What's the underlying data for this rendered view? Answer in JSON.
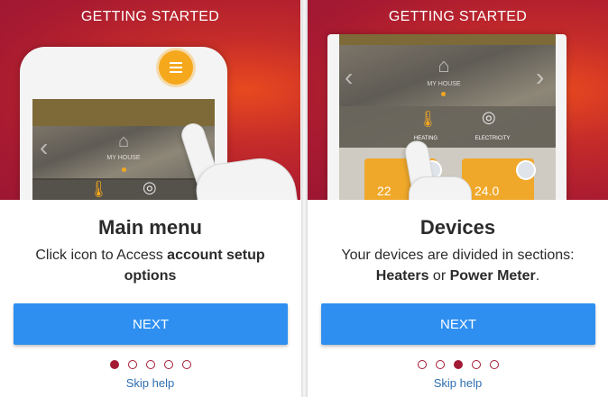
{
  "screens": [
    {
      "header_title": "GETTING STARTED",
      "mockup": {
        "home_label": "MY HOUSE"
      },
      "heading": "Main menu",
      "description": {
        "line1_text": "Click icon to Access ",
        "line1_bold": "account setup",
        "line2_bold": "options"
      },
      "next_label": "NEXT",
      "pager": {
        "total": 5,
        "active": 1
      },
      "skip_label": "Skip help"
    },
    {
      "header_title": "GETTING STARTED",
      "mockup": {
        "home_label": "MY HOUSE",
        "tab_heating": "HEATING",
        "tab_electricity": "ELECTRICITY",
        "card_left_value": "22",
        "card_right_value": "24.0"
      },
      "heading": "Devices",
      "description": {
        "line1_text": "Your devices are divided in sections:",
        "line2_bold_a": "Heaters",
        "line2_mid": " or ",
        "line2_bold_b": "Power Meter",
        "line2_end": "."
      },
      "next_label": "NEXT",
      "pager": {
        "total": 5,
        "active": 3
      },
      "skip_label": "Skip help"
    }
  ],
  "colors": {
    "brand_red": "#a31a34",
    "next_blue": "#2e8ff0",
    "accent_orange": "#f5a81c",
    "link_blue": "#2e6fb0"
  },
  "icons": [
    "menu-icon",
    "home-icon",
    "thermometer-icon",
    "electricity-icon",
    "hand-pointer-icon",
    "chevron-left-icon",
    "chevron-right-icon"
  ]
}
